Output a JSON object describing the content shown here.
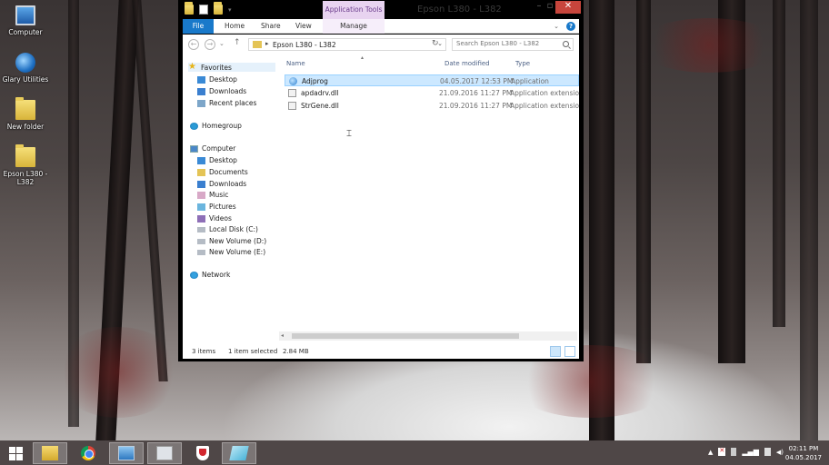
{
  "desktop": {
    "icons": [
      {
        "label": "Computer",
        "icon": "computer-icon"
      },
      {
        "label": "Glary Utilities",
        "icon": "glary-icon"
      },
      {
        "label": "New folder",
        "icon": "folder-icon"
      },
      {
        "label": "Epson L380 - L382",
        "icon": "folder-icon"
      }
    ]
  },
  "window": {
    "title": "Epson L380 - L382",
    "context_tab": "Application Tools",
    "ribbon_tabs": [
      "File",
      "Home",
      "Share",
      "View",
      "Manage"
    ],
    "address": {
      "path": "Epson L380 - L382",
      "search_placeholder": "Search Epson L380 - L382"
    },
    "nav": {
      "favorites": {
        "label": "Favorites",
        "items": [
          "Desktop",
          "Downloads",
          "Recent places"
        ]
      },
      "homegroup": "Homegroup",
      "computer": {
        "label": "Computer",
        "items": [
          "Desktop",
          "Documents",
          "Downloads",
          "Music",
          "Pictures",
          "Videos",
          "Local Disk (C:)",
          "New Volume (D:)",
          "New Volume (E:)"
        ]
      },
      "network": "Network"
    },
    "columns": {
      "name": "Name",
      "date": "Date modified",
      "type": "Type"
    },
    "files": [
      {
        "name": "Adjprog",
        "date": "04.05.2017 12:53 PM",
        "type": "Application",
        "selected": true
      },
      {
        "name": "apdadrv.dll",
        "date": "21.09.2016 11:27 PM",
        "type": "Application extension",
        "selected": false
      },
      {
        "name": "StrGene.dll",
        "date": "21.09.2016 11:27 PM",
        "type": "Application extension",
        "selected": false
      }
    ],
    "status": {
      "count": "3 items",
      "selection": "1 item selected",
      "size": "2.84 MB"
    }
  },
  "taskbar": {
    "clock_time": "02:11 PM",
    "clock_date": "04.05.2017"
  },
  "colors": {
    "accent": "#1979ca",
    "context_tab": "#e8d3f0",
    "selection": "#cce8ff",
    "taskbar": "#4f4747"
  }
}
